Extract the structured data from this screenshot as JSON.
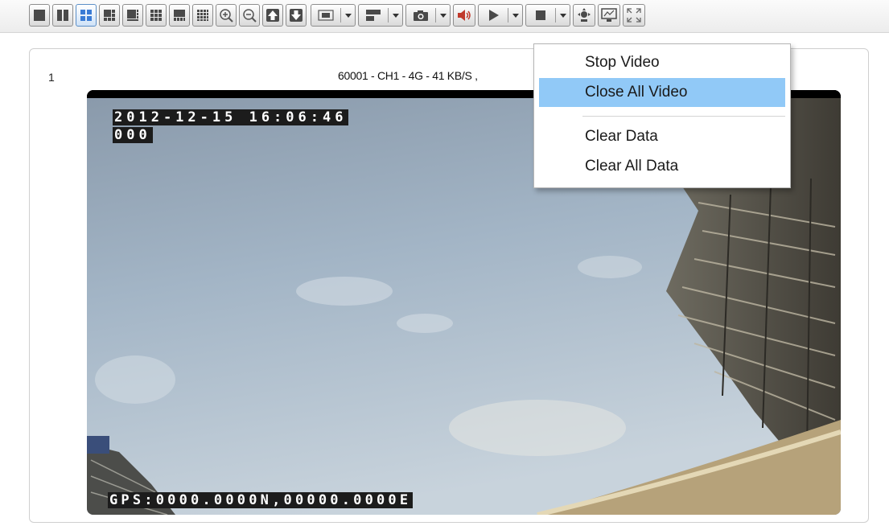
{
  "toolbar": {
    "buttons": [
      {
        "icon": "layout-1-icon"
      },
      {
        "icon": "layout-2-icon"
      },
      {
        "icon": "layout-4-icon",
        "active": true
      },
      {
        "icon": "layout-6-icon"
      },
      {
        "icon": "layout-8-icon"
      },
      {
        "icon": "layout-9-icon"
      },
      {
        "icon": "layout-10-icon"
      },
      {
        "icon": "layout-16-icon"
      },
      {
        "icon": "zoom-in-icon"
      },
      {
        "icon": "zoom-out-icon"
      },
      {
        "icon": "page-up-icon"
      },
      {
        "icon": "page-down-icon"
      },
      {
        "icon": "fullscreen-video-dropdown"
      },
      {
        "icon": "window-mode-dropdown"
      },
      {
        "icon": "camera-snapshot-dropdown"
      },
      {
        "icon": "sound-icon"
      },
      {
        "icon": "play-dropdown"
      },
      {
        "icon": "stop-dropdown"
      },
      {
        "icon": "ptz-control-icon"
      },
      {
        "icon": "monitor-icon"
      },
      {
        "icon": "fullscreen-icon"
      }
    ],
    "accent": "#3a7bd5"
  },
  "panel": {
    "number": "1",
    "title": "60001 - CH1 - 4G - 41 KB/S ,"
  },
  "video": {
    "osd_datetime": "2012-12-15 16:06:46",
    "osd_code": "000",
    "osd_gps": "GPS:0000.0000N,00000.0000E"
  },
  "context_menu": {
    "items": [
      {
        "label": "Stop Video"
      },
      {
        "label": "Close All Video",
        "highlighted": true
      },
      {
        "label": "Clear Data"
      },
      {
        "label": "Clear All Data"
      }
    ],
    "highlight_color": "#91c9f7"
  }
}
